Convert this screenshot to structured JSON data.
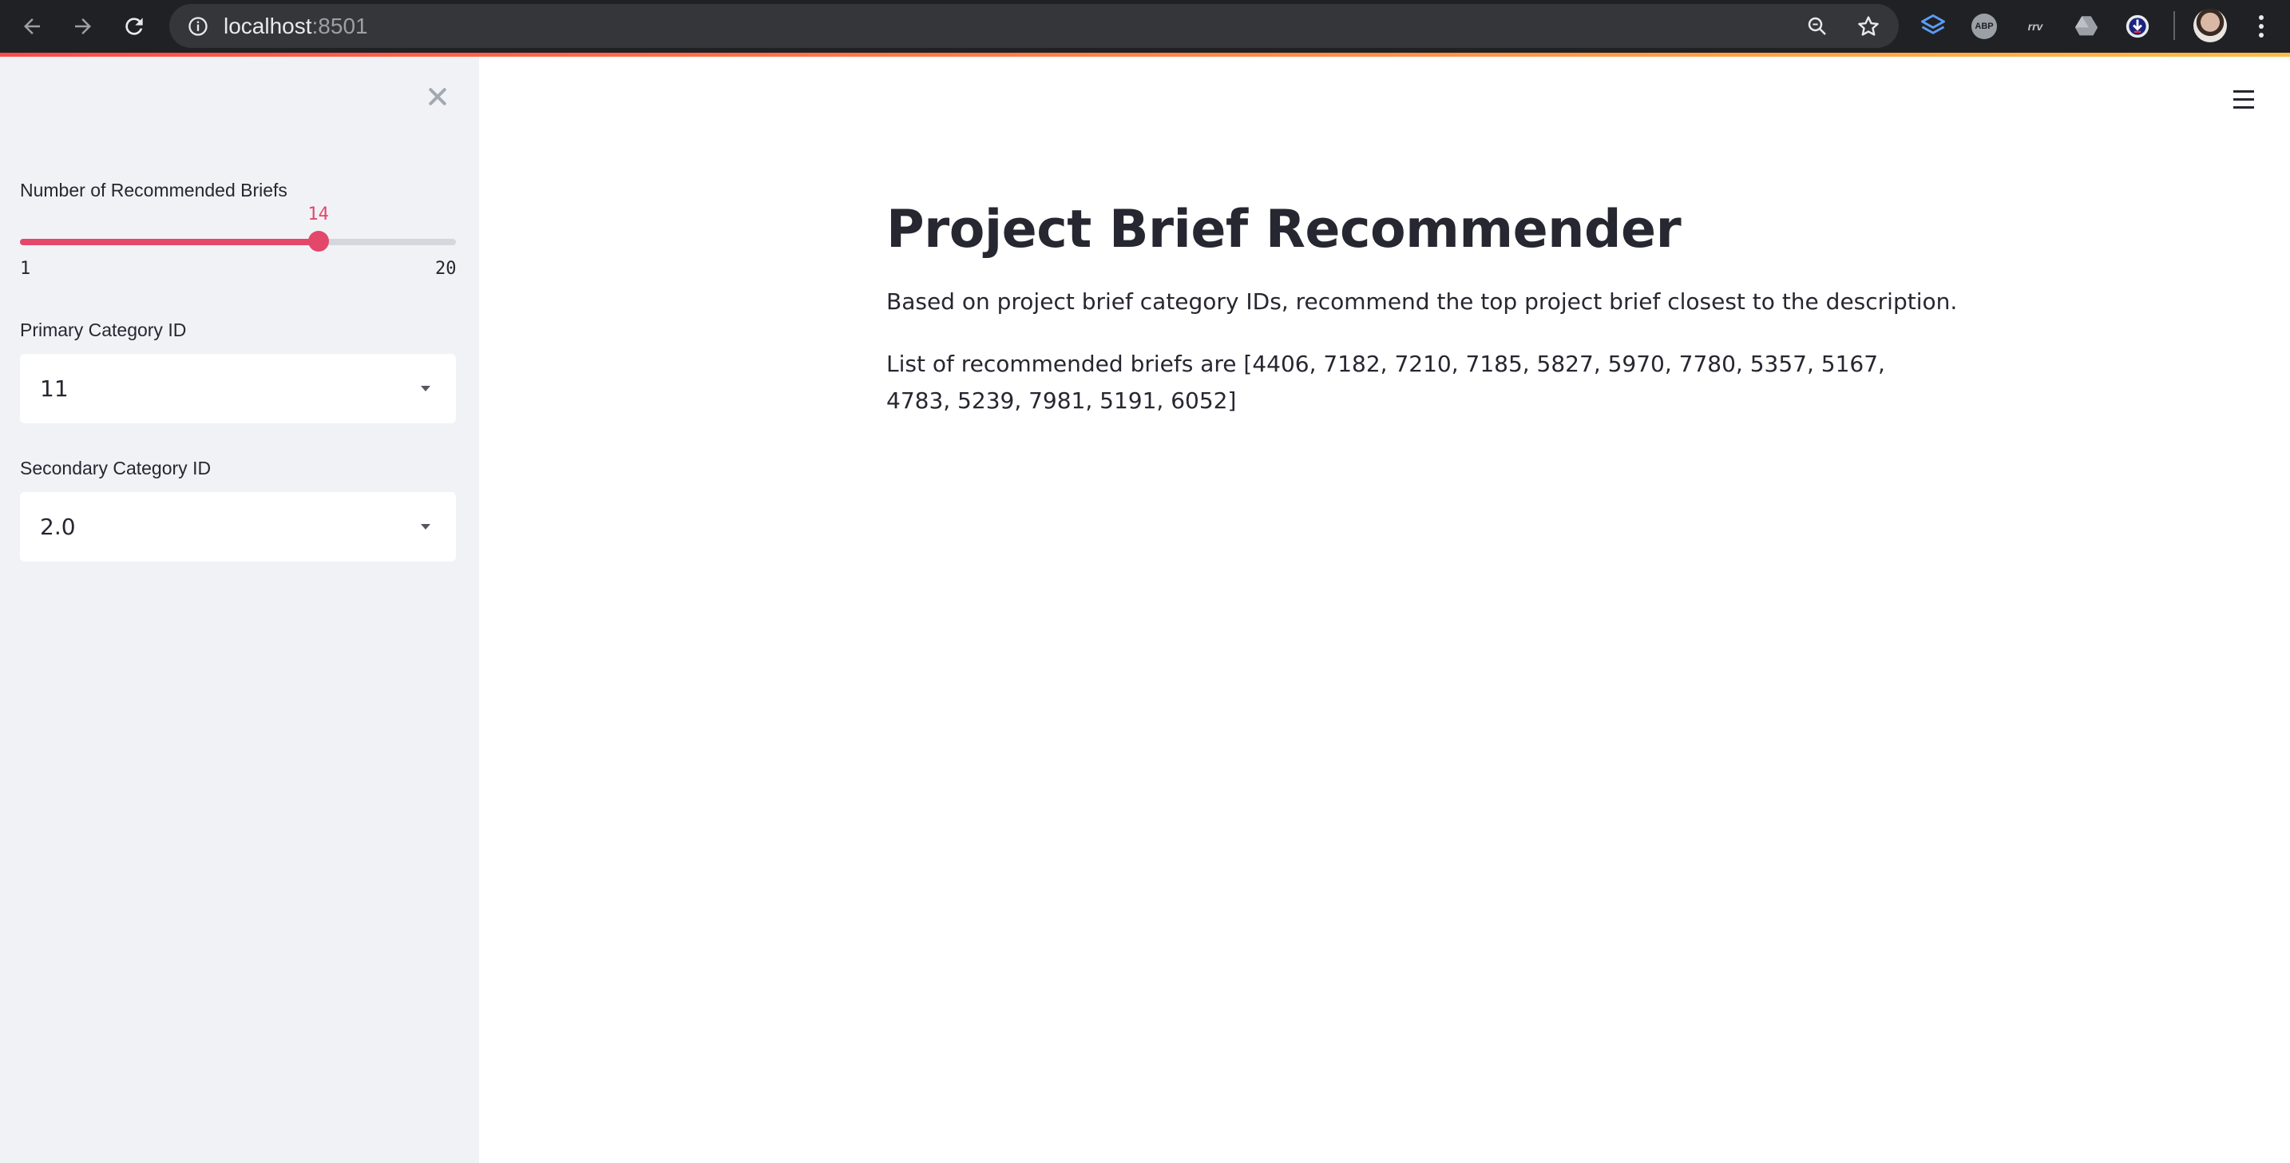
{
  "browser": {
    "url_host": "localhost",
    "url_port": ":8501"
  },
  "sidebar": {
    "slider": {
      "label": "Number of Recommended Briefs",
      "value": 14,
      "min": 1,
      "max": 20,
      "value_text": "14",
      "min_text": "1",
      "max_text": "20"
    },
    "primary_select": {
      "label": "Primary Category ID",
      "value": "11"
    },
    "secondary_select": {
      "label": "Secondary Category ID",
      "value": "2.0"
    }
  },
  "main": {
    "title": "Project Brief Recommender",
    "description": "Based on project brief category IDs, recommend the top project brief closest to the description.",
    "result_prefix": "List of recommended briefs are ",
    "result_text": "List of recommended briefs are [4406, 7182, 7210, 7185, 5827, 5970, 7780, 5357, 5167, 4783, 5239, 7981, 5191, 6052]",
    "recommended_ids": [
      4406,
      7182,
      7210,
      7185,
      5827,
      5970,
      7780,
      5357,
      5167,
      4783,
      5239,
      7981,
      5191,
      6052
    ]
  },
  "colors": {
    "accent": "#e3476a",
    "sidebar_bg": "#f0f2f6",
    "text": "#262730",
    "chrome_bg": "#202124"
  },
  "icons": {
    "back": "arrow-left-icon",
    "forward": "arrow-right-icon",
    "reload": "reload-icon",
    "info": "info-icon",
    "zoom": "zoom-icon",
    "bookmark": "star-icon",
    "close_sidebar": "close-icon",
    "menu": "hamburger-menu-icon"
  }
}
